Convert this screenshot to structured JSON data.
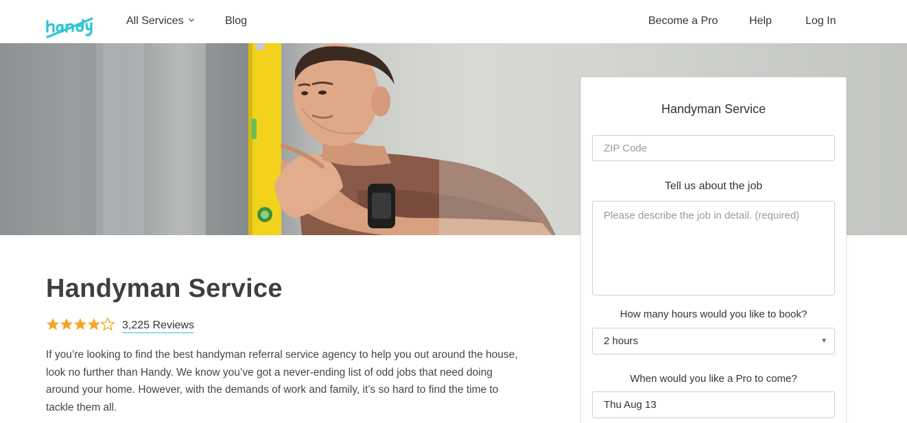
{
  "header": {
    "logo_text": "handy",
    "nav_left": [
      {
        "label": "All Services"
      },
      {
        "label": "Blog"
      }
    ],
    "nav_right": [
      {
        "label": "Become a Pro"
      },
      {
        "label": "Help"
      },
      {
        "label": "Log In"
      }
    ]
  },
  "booking": {
    "title": "Handyman Service",
    "zip_placeholder": "ZIP Code",
    "job_label": "Tell us about the job",
    "job_placeholder": "Please describe the job in detail. (required)",
    "hours_label": "How many hours would you like to book?",
    "hours_value": "2 hours",
    "when_label": "When would you like a Pro to come?",
    "date_value": "Thu Aug 13"
  },
  "main": {
    "title": "Handyman Service",
    "rating": 4.5,
    "rating_max": 5,
    "reviews_label": "3,225 Reviews",
    "description": "If you’re looking to find the best handyman referral service agency to help you out around the house, look no further than Handy. We know you’ve got a never-ending list of odd jobs that need doing around your home. However, with the demands of work and family, it’s so hard to find the time to tackle them all."
  },
  "colors": {
    "brand": "#2ec5d0",
    "star": "#f5a623",
    "text": "#3c3c3c",
    "level_yellow": "#f2d21b"
  },
  "icons": {
    "nav_dropdown": "chevron-down-icon",
    "select_arrow": "caret-down-icon",
    "rating": "star-icon"
  }
}
